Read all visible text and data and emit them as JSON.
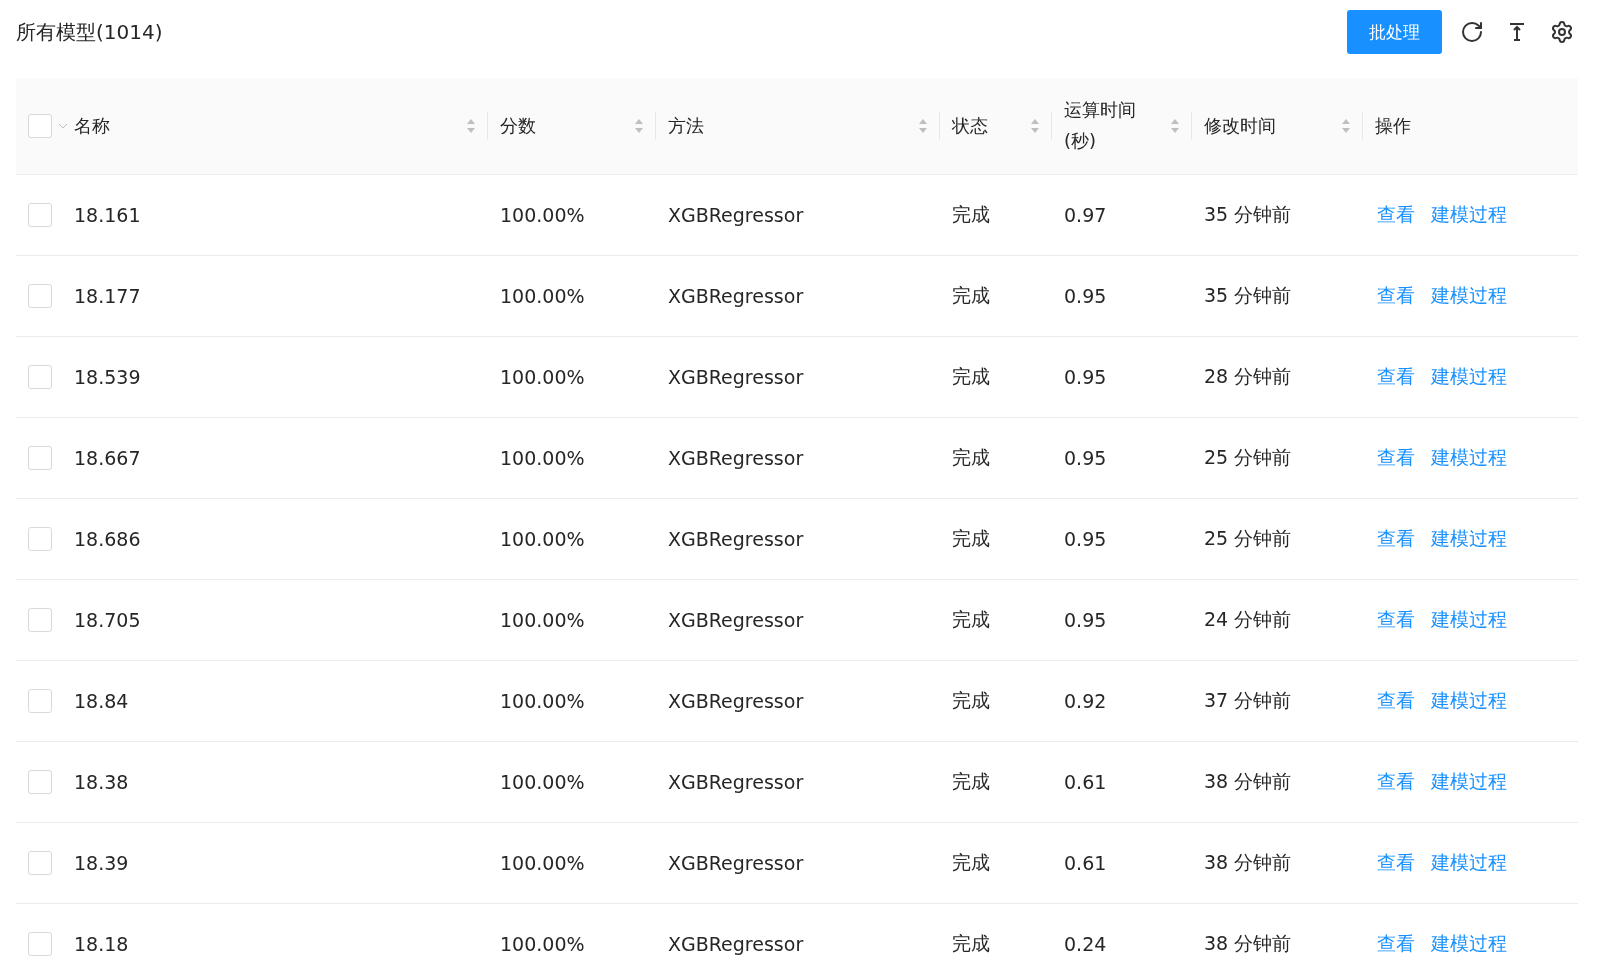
{
  "title": "所有模型(1014)",
  "toolbar": {
    "batch_button": "批处理"
  },
  "table": {
    "select_all_checked": false,
    "columns": [
      {
        "label": "名称",
        "sortable": true
      },
      {
        "label": "分数",
        "sortable": true
      },
      {
        "label": "方法",
        "sortable": true
      },
      {
        "label": "状态",
        "sortable": true
      },
      {
        "label": "运算时间(秒)",
        "sortable": true
      },
      {
        "label": "修改时间",
        "sortable": true
      },
      {
        "label": "操作",
        "sortable": false
      }
    ],
    "rows": [
      {
        "checked": false,
        "cells": [
          "18.161",
          "100.00%",
          "XGBRegressor",
          "完成",
          "0.97",
          "35 分钟前"
        ],
        "actions": [
          "查看",
          "建模过程"
        ]
      },
      {
        "checked": false,
        "cells": [
          "18.177",
          "100.00%",
          "XGBRegressor",
          "完成",
          "0.95",
          "35 分钟前"
        ],
        "actions": [
          "查看",
          "建模过程"
        ]
      },
      {
        "checked": false,
        "cells": [
          "18.539",
          "100.00%",
          "XGBRegressor",
          "完成",
          "0.95",
          "28 分钟前"
        ],
        "actions": [
          "查看",
          "建模过程"
        ]
      },
      {
        "checked": false,
        "cells": [
          "18.667",
          "100.00%",
          "XGBRegressor",
          "完成",
          "0.95",
          "25 分钟前"
        ],
        "actions": [
          "查看",
          "建模过程"
        ]
      },
      {
        "checked": false,
        "cells": [
          "18.686",
          "100.00%",
          "XGBRegressor",
          "完成",
          "0.95",
          "25 分钟前"
        ],
        "actions": [
          "查看",
          "建模过程"
        ]
      },
      {
        "checked": false,
        "cells": [
          "18.705",
          "100.00%",
          "XGBRegressor",
          "完成",
          "0.95",
          "24 分钟前"
        ],
        "actions": [
          "查看",
          "建模过程"
        ]
      },
      {
        "checked": false,
        "cells": [
          "18.84",
          "100.00%",
          "XGBRegressor",
          "完成",
          "0.92",
          "37 分钟前"
        ],
        "actions": [
          "查看",
          "建模过程"
        ]
      },
      {
        "checked": false,
        "cells": [
          "18.38",
          "100.00%",
          "XGBRegressor",
          "完成",
          "0.61",
          "38 分钟前"
        ],
        "actions": [
          "查看",
          "建模过程"
        ]
      },
      {
        "checked": false,
        "cells": [
          "18.39",
          "100.00%",
          "XGBRegressor",
          "完成",
          "0.61",
          "38 分钟前"
        ],
        "actions": [
          "查看",
          "建模过程"
        ]
      },
      {
        "checked": false,
        "cells": [
          "18.18",
          "100.00%",
          "XGBRegressor",
          "完成",
          "0.24",
          "38 分钟前"
        ],
        "actions": [
          "查看",
          "建模过程"
        ]
      }
    ]
  }
}
